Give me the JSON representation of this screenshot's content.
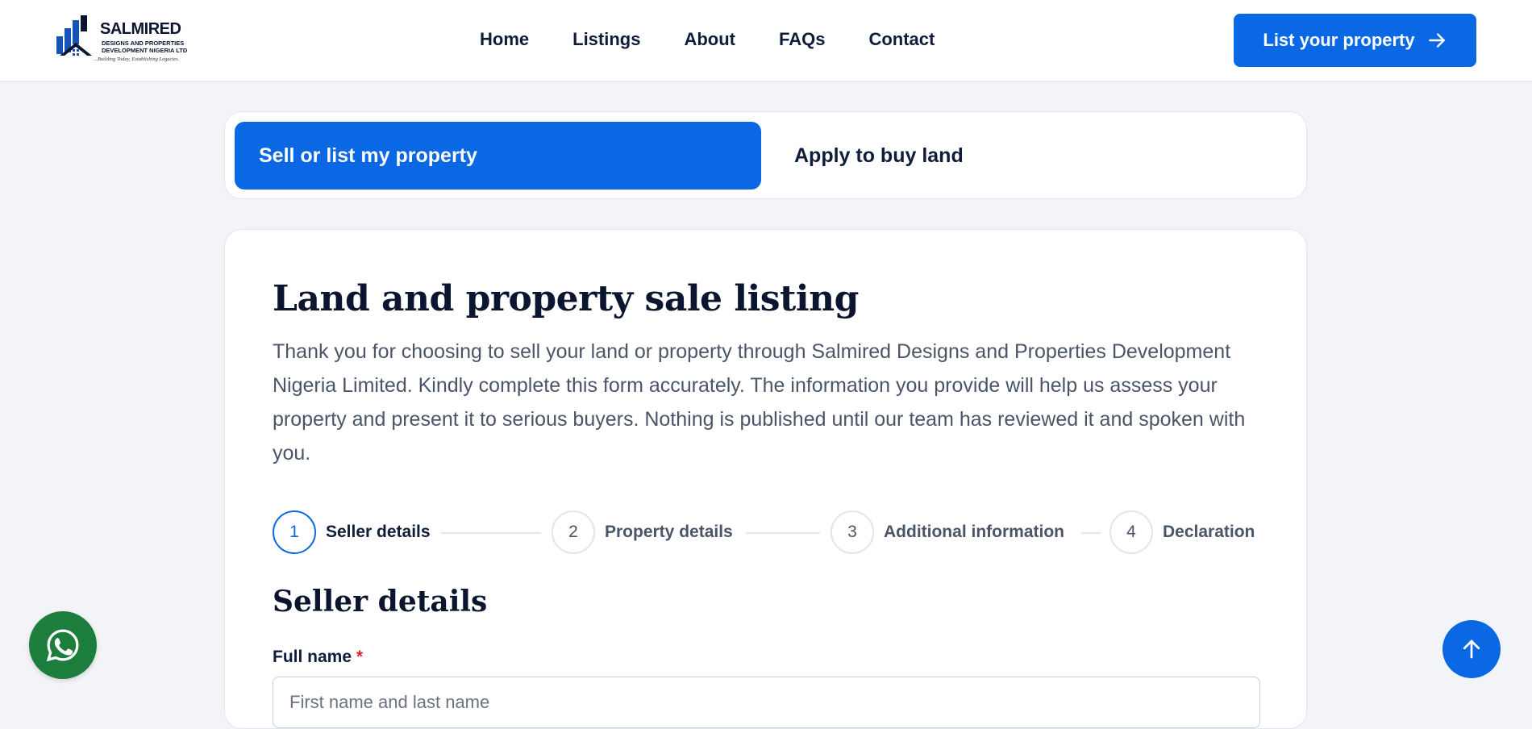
{
  "header": {
    "logo": {
      "brand": "SALMIRED",
      "line1": "DESIGNS AND PROPERTIES",
      "line2": "DEVELOPMENT NIGERIA LTD",
      "tagline": "...Building Today, Establishing Legacies."
    },
    "nav": [
      "Home",
      "Listings",
      "About",
      "FAQs",
      "Contact"
    ],
    "cta_label": "List your property"
  },
  "tabs": {
    "active": "Sell or list my property",
    "inactive": "Apply to buy land"
  },
  "form": {
    "title": "Land and property sale listing",
    "intro": "Thank you for choosing to sell your land or property through Salmired Designs and Properties Development Nigeria Limited. Kindly complete this form accurately. The information you provide will help us assess your property and present it to serious buyers. Nothing is published until our team has reviewed it and spoken with you.",
    "steps": [
      {
        "number": "1",
        "label": "Seller details",
        "active": true
      },
      {
        "number": "2",
        "label": "Property details",
        "active": false
      },
      {
        "number": "3",
        "label": "Additional information",
        "active": false
      },
      {
        "number": "4",
        "label": "Declaration",
        "active": false
      }
    ],
    "section_title": "Seller details",
    "full_name": {
      "label": "Full name",
      "required_mark": "*",
      "placeholder": "First name and last name",
      "value": ""
    }
  },
  "colors": {
    "accent": "#0a68e5",
    "whatsapp": "#1c7d3c",
    "heading": "#0b1530",
    "background": "#f3f4f7"
  },
  "icons": {
    "cta": "arrow-right-icon",
    "whatsapp": "whatsapp-icon",
    "to_top": "arrow-up-icon"
  }
}
